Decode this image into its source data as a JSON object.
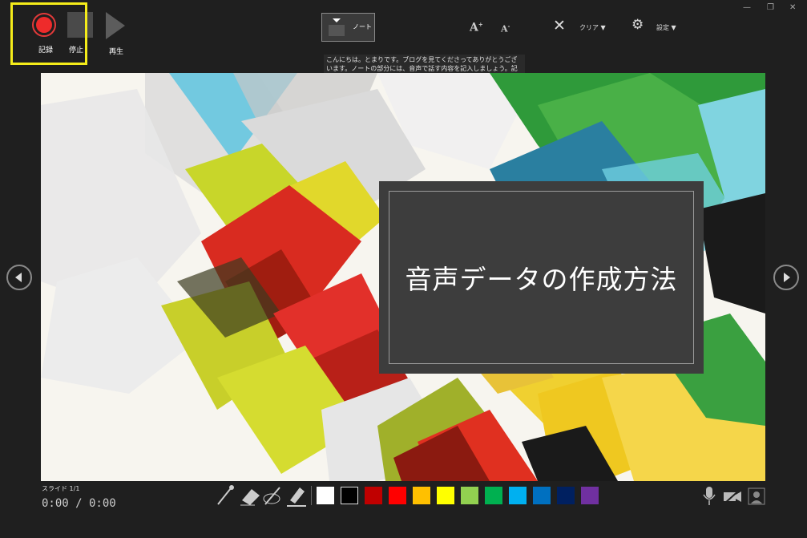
{
  "toolbar": {
    "record_label": "記録",
    "stop_label": "停止",
    "play_label": "再生",
    "notes_label": "ノート",
    "clear_label": "クリア ▼",
    "settings_label": "設定 ▼",
    "font_increase": "A",
    "font_decrease": "A"
  },
  "notes": {
    "text": "こんにちは。とまりです。ブログを見てくださってありがとうございます。ノートの部分には、音声で話す内容を記入しましょう。記入内容を見ながら音声を録音できるのでとても便利です。"
  },
  "slide": {
    "title": "音声データの作成方法"
  },
  "status": {
    "slide_counter": "スライド 1/1",
    "time": "0:00 / 0:00"
  },
  "colors": {
    "swatches": [
      "#ffffff",
      "#000000",
      "#c00000",
      "#ff0000",
      "#ffc000",
      "#ffff00",
      "#92d050",
      "#00b050",
      "#00b0f0",
      "#0070c0",
      "#002060",
      "#7030a0"
    ],
    "highlight": "#f5ec1a",
    "record": "#ee2b2b"
  },
  "icons": [
    "record-icon",
    "stop-icon",
    "play-icon",
    "notes-icon",
    "font-increase-icon",
    "font-decrease-icon",
    "clear-icon",
    "settings-icon",
    "pen-icon",
    "eraser-icon",
    "laser-pointer-icon",
    "highlighter-icon",
    "microphone-icon",
    "camera-icon",
    "camera-preview-icon",
    "prev-slide-icon",
    "next-slide-icon"
  ]
}
